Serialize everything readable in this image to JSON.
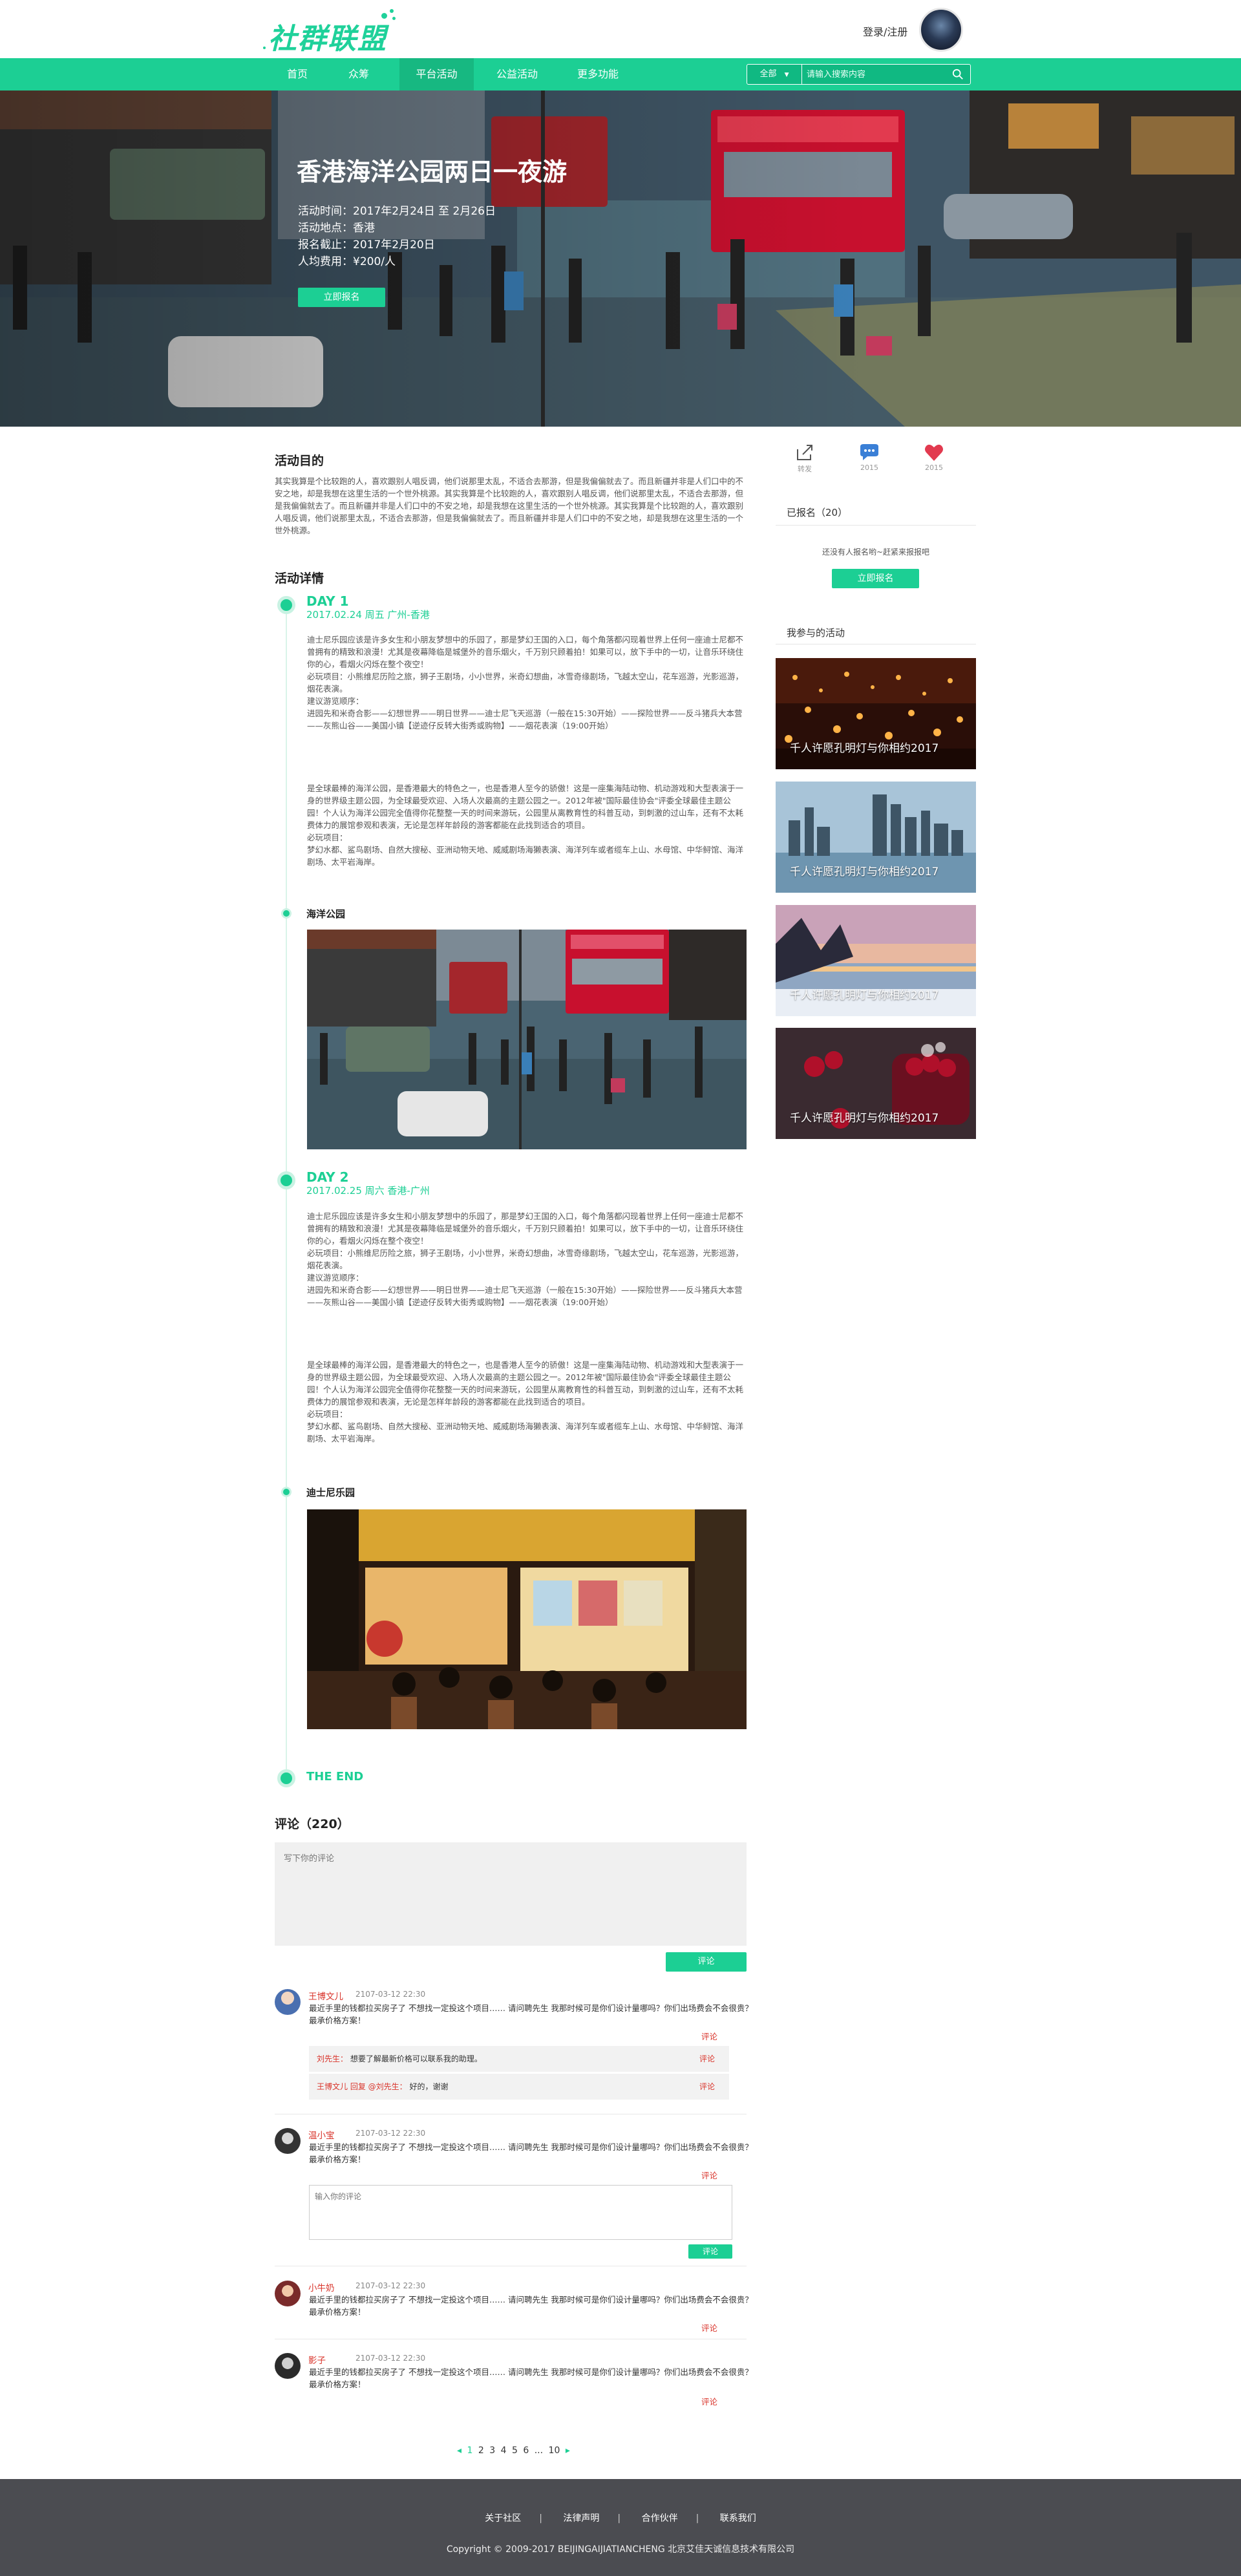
{
  "header": {
    "logo_text": "社群联盟",
    "login_label": "登录/注册"
  },
  "nav": {
    "items": [
      "首页",
      "众筹",
      "平台活动",
      "公益活动",
      "更多功能"
    ],
    "active_index": 2,
    "search_scope": "全部",
    "search_placeholder": "请输入搜索内容",
    "brand_color": "#1ccf94"
  },
  "hero": {
    "title": "香港海洋公园两日一夜游",
    "meta": [
      "活动时间：2017年2月24日 至 2月26日",
      "活动地点：香港",
      "报名截止：2017年2月20日",
      "人均费用：¥200/人"
    ],
    "button_label": "立即报名"
  },
  "purpose": {
    "title": "活动目的",
    "text": "其实我算是个比较跑的人，喜欢跟别人唱反调，他们说那里太乱，不适合去那游，但是我偏偏就去了。而且新疆并非是人们口中的不安之地，却是我想在这里生活的一个世外桃源。其实我算是个比较跑的人，喜欢跟别人唱反调，他们说那里太乱，不适合去那游，但是我偏偏就去了。而且新疆并非是人们口中的不安之地，却是我想在这里生活的一个世外桃源。其实我算是个比较跑的人，喜欢跟别人唱反调，他们说那里太乱，不适合去那游，但是我偏偏就去了。而且新疆并非是人们口中的不安之地，却是我想在这里生活的一个世外桃源。"
  },
  "details": {
    "title": "活动详情",
    "days": [
      {
        "label": "DAY 1",
        "sub": "2017.02.24  周五  广州-香港",
        "para1": "迪士尼乐园应该是许多女生和小朋友梦想中的乐园了，那是梦幻王国的入口，每个角落都闪现着世界上任何一座迪士尼都不曾拥有的精致和浪漫！尤其是夜幕降临是城堡外的音乐烟火，千万别只顾着拍！如果可以，放下手中的一切，让音乐环绕住你的心，看烟火闪烁在整个夜空！\n必玩项目：小熊维尼历险之旅，狮子王剧场，小小世界，米奇幻想曲，冰雪奇缘剧场，飞越太空山，花车巡游，光影巡游，烟花表演。\n建议游览顺序：\n进园先和米奇合影——幻想世界——明日世界——迪士尼飞天巡游（一般在15:30开始）——探险世界——反斗猪兵大本营——灰熊山谷——美国小镇【逆迹仔反转大街秀或购物】——烟花表演（19:00开始）",
        "para2": "是全球最棒的海洋公园，是香港最大的特色之一，也是香港人至今的骄傲！这是一座集海陆动物、机动游戏和大型表演于一身的世界级主题公园，为全球最受欢迎、入场人次最高的主题公园之一。2012年被\"国际最佳协会\"评委全球最佳主题公园！个人认为海洋公园完全值得你花整整一天的时间来游玩，公园里从离教育性的科普互动，到刺激的过山车，还有不太耗费体力的展馆参观和表演，无论是怎样年龄段的游客都能在此找到适合的项目。\n必玩项目：\n梦幻水都、鲨鸟剧场、自然大搜秘、亚洲动物天地、威威剧场海獭表演、海洋列车或者缆车上山、水母馆、中华鲟馆、海洋剧场、太平岩海岸。",
        "place": "海洋公园"
      },
      {
        "label": "DAY 2",
        "sub": "2017.02.25  周六  香港-广州",
        "para1": "迪士尼乐园应该是许多女生和小朋友梦想中的乐园了，那是梦幻王国的入口，每个角落都闪现着世界上任何一座迪士尼都不曾拥有的精致和浪漫！尤其是夜幕降临是城堡外的音乐烟火，千万别只顾着拍！如果可以，放下手中的一切，让音乐环绕住你的心，看烟火闪烁在整个夜空！\n必玩项目：小熊维尼历险之旅，狮子王剧场，小小世界，米奇幻想曲，冰雪奇缘剧场，飞越太空山，花车巡游，光影巡游，烟花表演。\n建议游览顺序：\n进园先和米奇合影——幻想世界——明日世界——迪士尼飞天巡游（一般在15:30开始）——探险世界——反斗猪兵大本营——灰熊山谷——美国小镇【逆迹仔反转大街秀或购物】——烟花表演（19:00开始）",
        "para2": "是全球最棒的海洋公园，是香港最大的特色之一，也是香港人至今的骄傲！这是一座集海陆动物、机动游戏和大型表演于一身的世界级主题公园，为全球最受欢迎、入场人次最高的主题公园之一。2012年被\"国际最佳协会\"评委全球最佳主题公园！个人认为海洋公园完全值得你花整整一天的时间来游玩，公园里从离教育性的科普互动，到刺激的过山车，还有不太耗费体力的展馆参观和表演，无论是怎样年龄段的游客都能在此找到适合的项目。\n必玩项目：\n梦幻水都、鲨鸟剧场、自然大搜秘、亚洲动物天地、威威剧场海獭表演、海洋列车或者缆车上山、水母馆、中华鲟馆、海洋剧场、太平岩海岸。",
        "place": "迪士尼乐园"
      }
    ],
    "end_label": "THE END"
  },
  "sidebar": {
    "actions": [
      {
        "icon": "share-icon",
        "label": "转发"
      },
      {
        "icon": "comment-icon",
        "label": "2015"
      },
      {
        "icon": "heart-icon",
        "label": "2015"
      }
    ],
    "signed_up": "已报名（20）",
    "none_note": "还没有人报名哟~赶紧来报报吧",
    "signup_button": "立即报名",
    "my_activities_title": "我参与的活动",
    "activities": [
      "千人许愿孔明灯与你相约2017",
      "千人许愿孔明灯与你相约2017",
      "千人许愿孔明灯与你相约2017",
      "千人许愿孔明灯与你相约2017"
    ]
  },
  "comments": {
    "title": "评论（220）",
    "placeholder": "写下你的评论",
    "submit_label": "评论",
    "items": [
      {
        "name": "王博文儿",
        "time": "2107-03-12  22:30",
        "text": "最近手里的钱都拉买房子了 不想找一定投这个项目…… 请问聘先生 我那时候可是你们设计量哪吗？你们出场费会不会很贵？最承价格方案！",
        "reply_label": "评论",
        "replies": [
          {
            "from": "刘先生：",
            "text": "想要了解最新价格可以联系我的助理。",
            "action": "评论"
          },
          {
            "from": "王博文儿 回复 @刘先生：",
            "text": "好的，谢谢",
            "action": "评论"
          }
        ]
      },
      {
        "name": "温小宝",
        "time": "2107-03-12  22:30",
        "text": "最近手里的钱都拉买房子了 不想找一定投这个项目…… 请问聘先生 我那时候可是你们设计量哪吗？你们出场费会不会很贵？最承价格方案！",
        "reply_label": "评论",
        "reply_placeholder": "输入你的评论",
        "reply_submit": "评论"
      },
      {
        "name": "小牛奶",
        "time": "2107-03-12  22:30",
        "text": "最近手里的钱都拉买房子了 不想找一定投这个项目…… 请问聘先生 我那时候可是你们设计量哪吗？你们出场费会不会很贵？最承价格方案！",
        "reply_label": "评论"
      },
      {
        "name": "影子",
        "time": "2107-03-12  22:30",
        "text": "最近手里的钱都拉买房子了 不想找一定投这个项目…… 请问聘先生 我那时候可是你们设计量哪吗？你们出场费会不会很贵？最承价格方案！",
        "reply_label": "评论"
      }
    ]
  },
  "pagination": {
    "prev": "◂",
    "pages": [
      "1",
      "2",
      "3",
      "4",
      "5",
      "6",
      "...",
      "10"
    ],
    "current": "1",
    "next": "▸"
  },
  "footer": {
    "links": [
      "关于社区",
      "法律声明",
      "合作伙伴",
      "联系我们"
    ],
    "copyright": "Copyright © 2009-2017 BEIJINGAIJIATIANCHENG 北京艾佳天诚信息技术有限公司"
  }
}
